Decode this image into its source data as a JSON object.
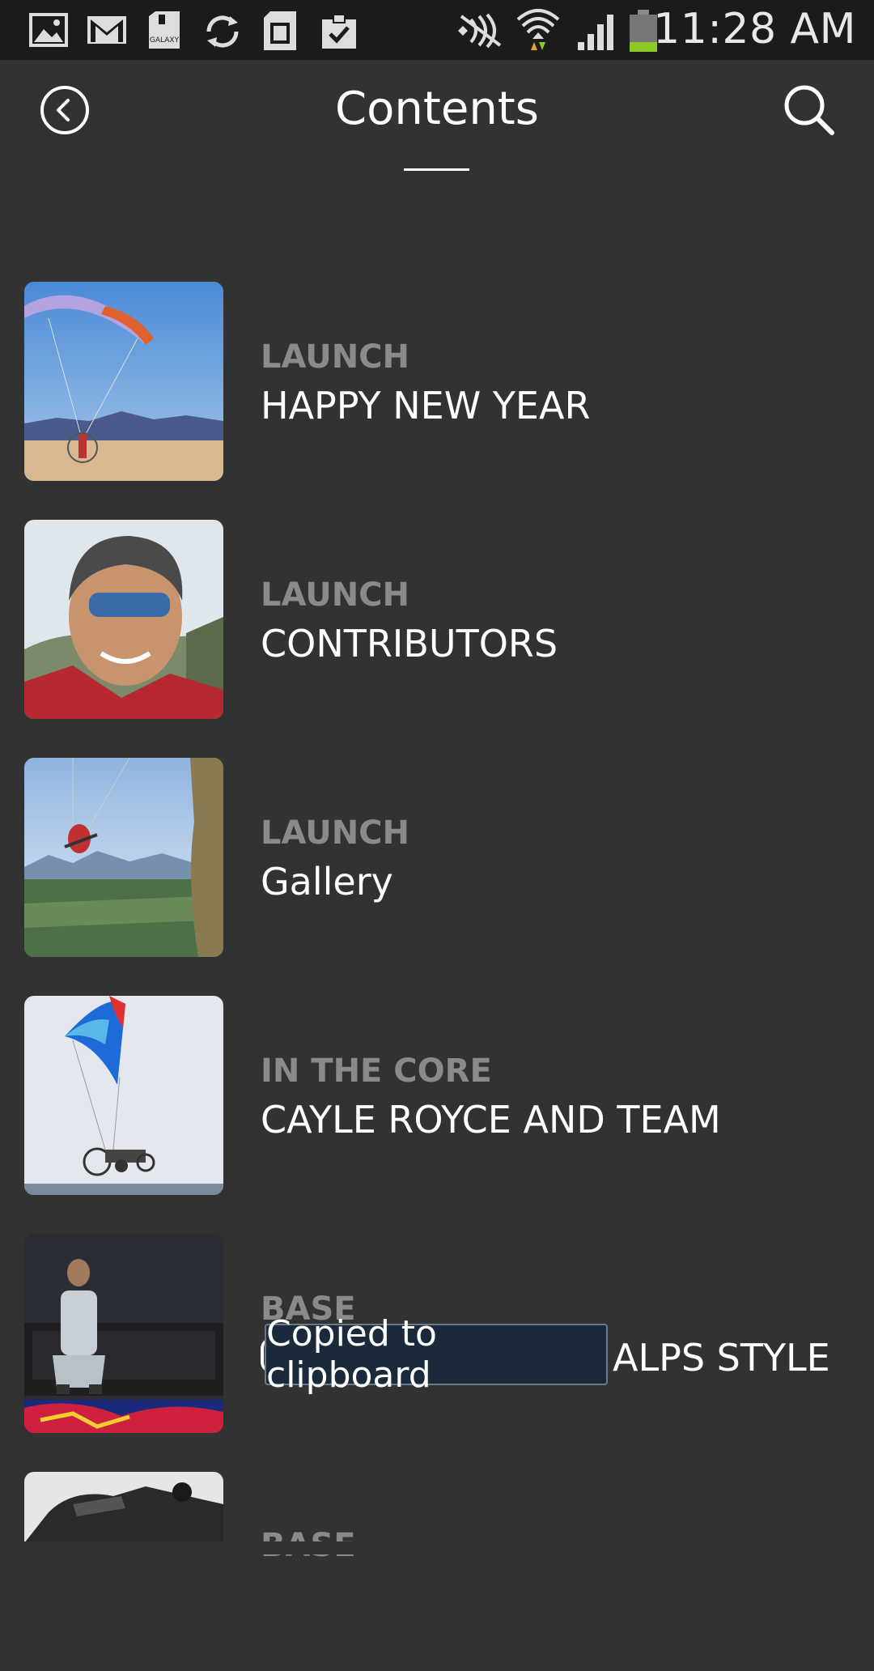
{
  "status_bar": {
    "time": "11:28 AM",
    "left_icons": [
      "gallery-icon",
      "gmail-icon",
      "galaxy-sdcard-icon",
      "sync-icon",
      "sim-card-icon",
      "clipboard-check-icon"
    ],
    "right_icons": [
      "nfc-icon",
      "wifi-icon",
      "signal-icon",
      "battery-icon"
    ],
    "battery_color": "#8ac926"
  },
  "header": {
    "title": "Contents",
    "back_icon": "back-circle-icon",
    "search_icon": "search-icon"
  },
  "items": [
    {
      "category": "LAUNCH",
      "title": "HAPPY NEW YEAR",
      "thumb": "paraglider-beach"
    },
    {
      "category": "LAUNCH",
      "title": "CONTRIBUTORS",
      "thumb": "pilot-selfie"
    },
    {
      "category": "LAUNCH",
      "title": "Gallery",
      "thumb": "paraglider-valley"
    },
    {
      "category": "IN THE CORE",
      "title": "CAYLE ROYCE AND TEAM",
      "thumb": "paramotor-trike"
    },
    {
      "category": "BASE",
      "title": "ALPS STYLE",
      "thumb": "man-on-sofa"
    },
    {
      "category": "BASE",
      "title": "",
      "thumb": "engine-closeup"
    }
  ],
  "toast": {
    "text": "Copied to clipboard"
  },
  "colors": {
    "background": "#323232",
    "status_bar": "#1b1b1b",
    "category_text": "#8a8a8a",
    "toast_bg": "#1a2a3a"
  }
}
